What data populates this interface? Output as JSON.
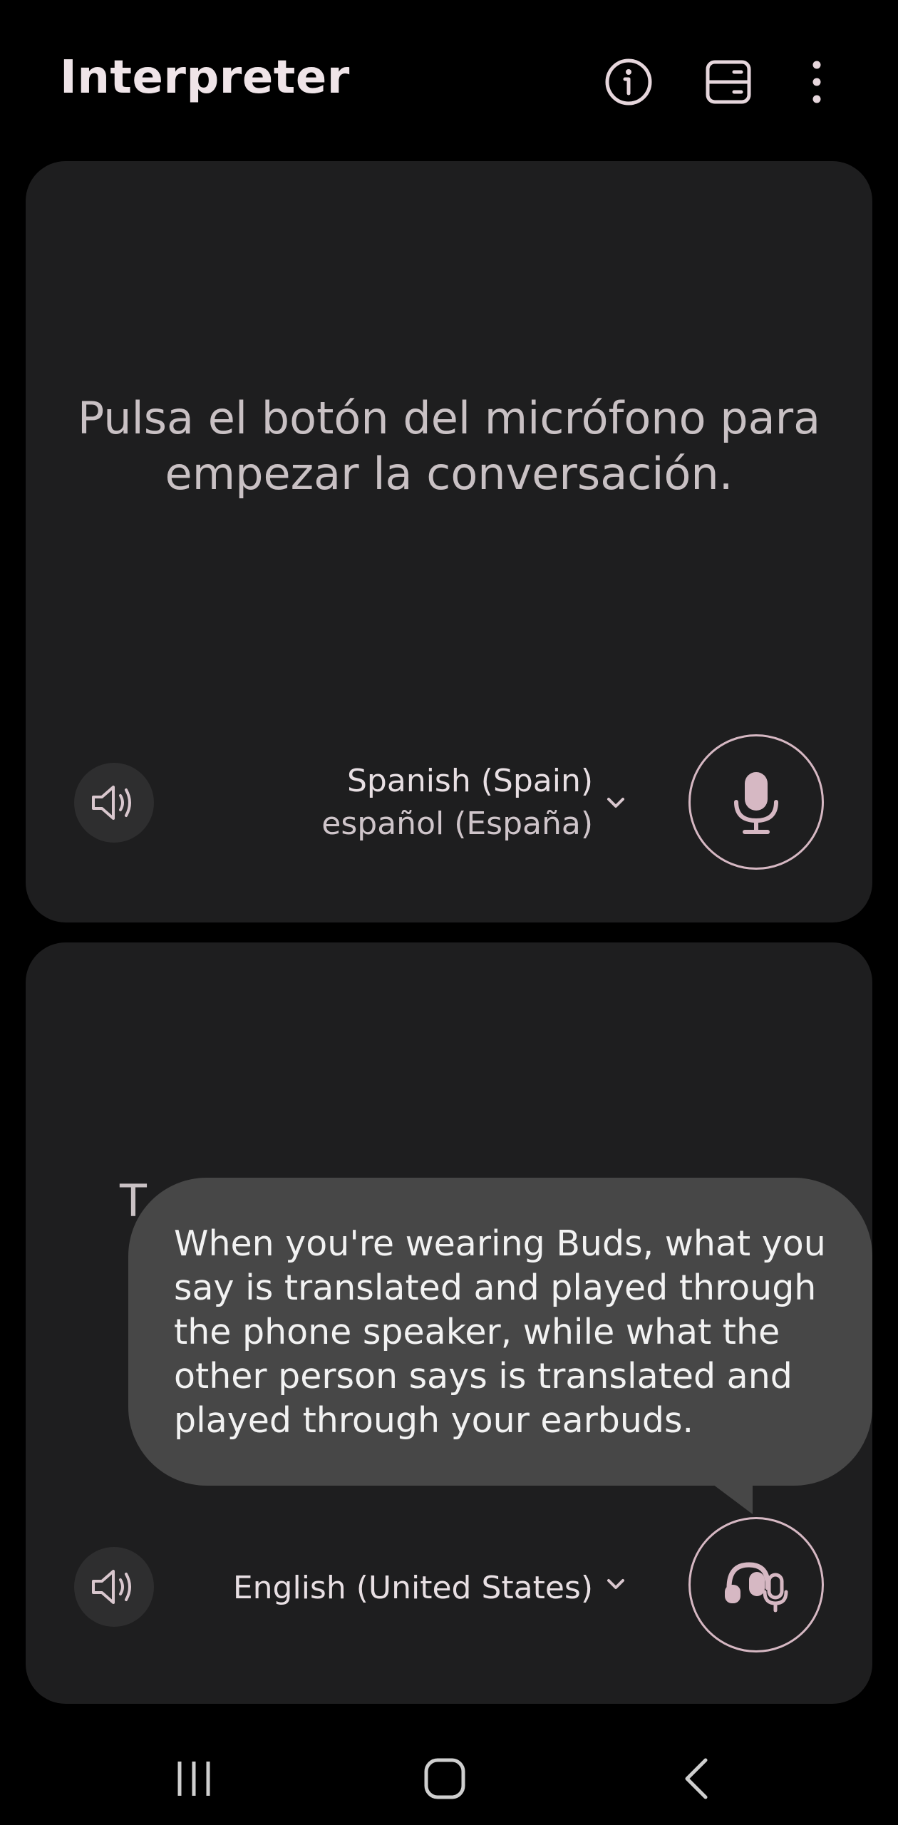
{
  "header": {
    "title": "Interpreter",
    "icons": [
      "info-icon",
      "layout-toggle-icon",
      "more-options-icon"
    ]
  },
  "top_panel": {
    "prompt": "Pulsa el botón del micrófono para empezar la conversación.",
    "language": {
      "name": "Spanish (Spain)",
      "native_name": "español (España)"
    },
    "speaker_icon": "speaker-icon",
    "mic_icon": "microphone-icon"
  },
  "bottom_panel": {
    "partial_text": "T",
    "language": {
      "name": "English (United States)"
    },
    "speaker_icon": "speaker-icon",
    "mic_icon": "earbuds-mic-icon"
  },
  "tooltip": {
    "text": "When you're wearing Buds, what you say is translated and played through the phone speaker, while what the other person says is translated and played through your earbuds."
  },
  "navbar": {
    "icons": [
      "recent-apps-icon",
      "home-icon",
      "back-icon"
    ]
  },
  "colors": {
    "background": "#000000",
    "panel": "#1e1e1f",
    "accent": "#d6b8c3",
    "tooltip": "#474747"
  }
}
